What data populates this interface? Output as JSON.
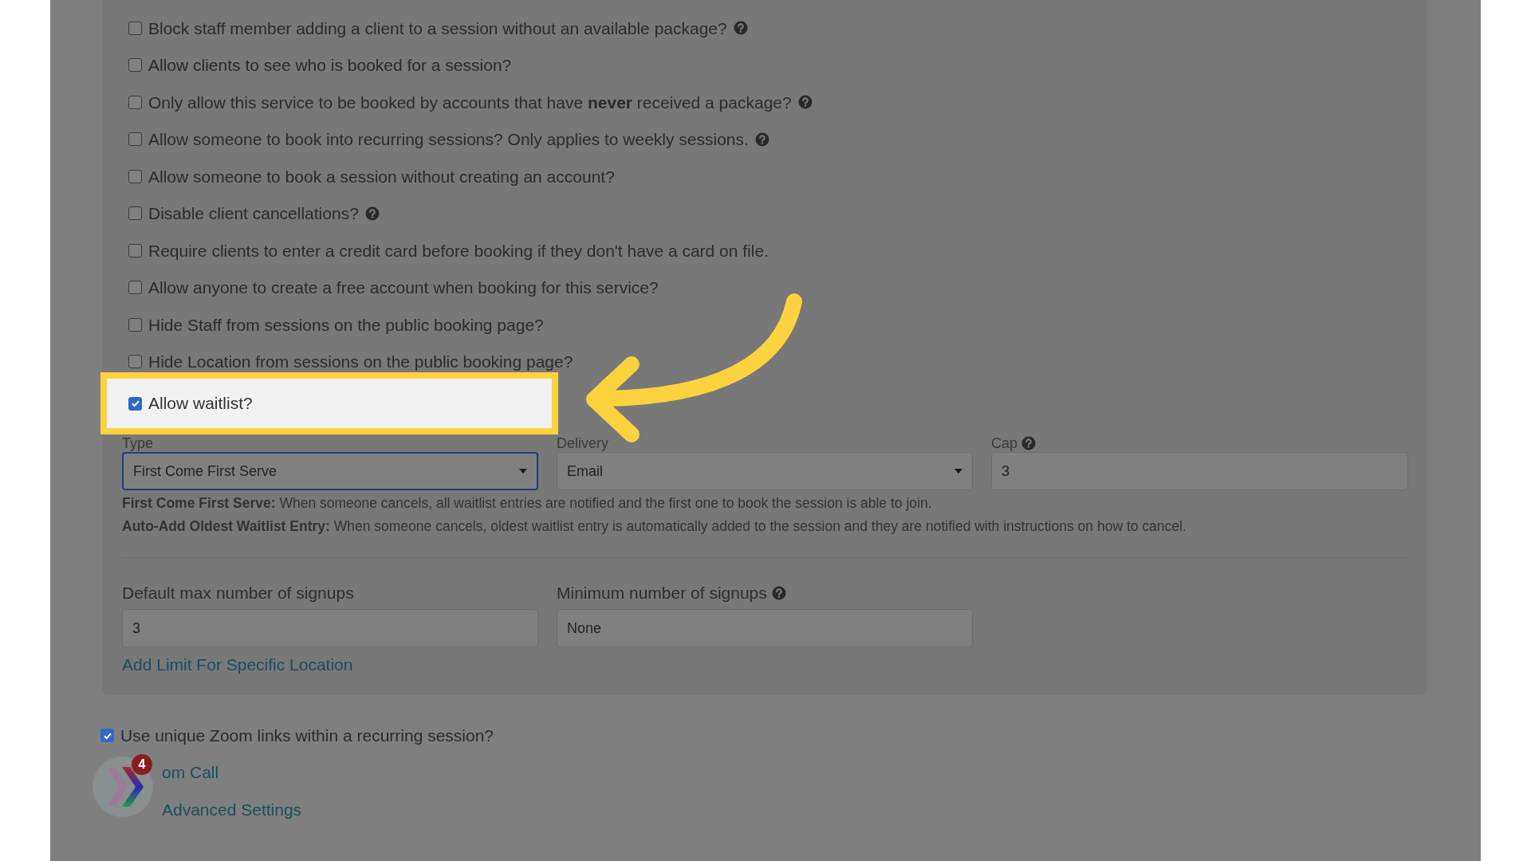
{
  "options": [
    {
      "label": "Block staff member adding a client to a session without an available package?",
      "checked": false,
      "help": true
    },
    {
      "label": "Allow clients to see who is booked for a session?",
      "checked": false,
      "help": false
    },
    {
      "label": "Only allow this service to be booked by accounts that have **never** received a package?",
      "checked": false,
      "help": true
    },
    {
      "label": "Allow someone to book into recurring sessions? Only applies to weekly sessions.",
      "checked": false,
      "help": true
    },
    {
      "label": "Allow someone to book a session without creating an account?",
      "checked": false,
      "help": false
    },
    {
      "label": "Disable client cancellations?",
      "checked": false,
      "help": true
    },
    {
      "label": "Require clients to enter a credit card before booking if they don't have a card on file.",
      "checked": false,
      "help": false
    },
    {
      "label": "Allow anyone to create a free account when booking for this service?",
      "checked": false,
      "help": false
    },
    {
      "label": "Hide Staff from sessions on the public booking page?",
      "checked": false,
      "help": false
    },
    {
      "label": "Hide Location from sessions on the public booking page?",
      "checked": false,
      "help": false
    }
  ],
  "waitlist": {
    "label": "Allow waitlist?",
    "checked": true,
    "highlighted": true
  },
  "waitlist_fields": [
    {
      "kind": "select",
      "label": "Type",
      "value": "First Come First Serve",
      "focused": true,
      "help": false
    },
    {
      "kind": "select",
      "label": "Delivery",
      "value": "Email",
      "focused": false,
      "help": false
    },
    {
      "kind": "input",
      "label": "Cap",
      "value": "3",
      "focused": false,
      "help": true
    }
  ],
  "waitlist_help": [
    "**First Come First Serve:** When someone cancels, all waitlist entries are notified and the first one to book the session is able to join.",
    "**Auto-Add Oldest Waitlist Entry:** When someone cancels, oldest waitlist entry is automatically added to the session and they are notified with instructions on how to cancel."
  ],
  "signup_fields": [
    {
      "label": "Default max number of signups",
      "value": "3",
      "help": false
    },
    {
      "label": "Minimum number of signups",
      "value": "None",
      "help": true
    }
  ],
  "limit_link": "Add Limit For Specific Location",
  "zoom_option": {
    "label": "Use unique Zoom links within a recurring session?",
    "checked": true
  },
  "links": [
    "om Call",
    "Advanced Settings"
  ],
  "chat_widget": {
    "badge": "4"
  }
}
